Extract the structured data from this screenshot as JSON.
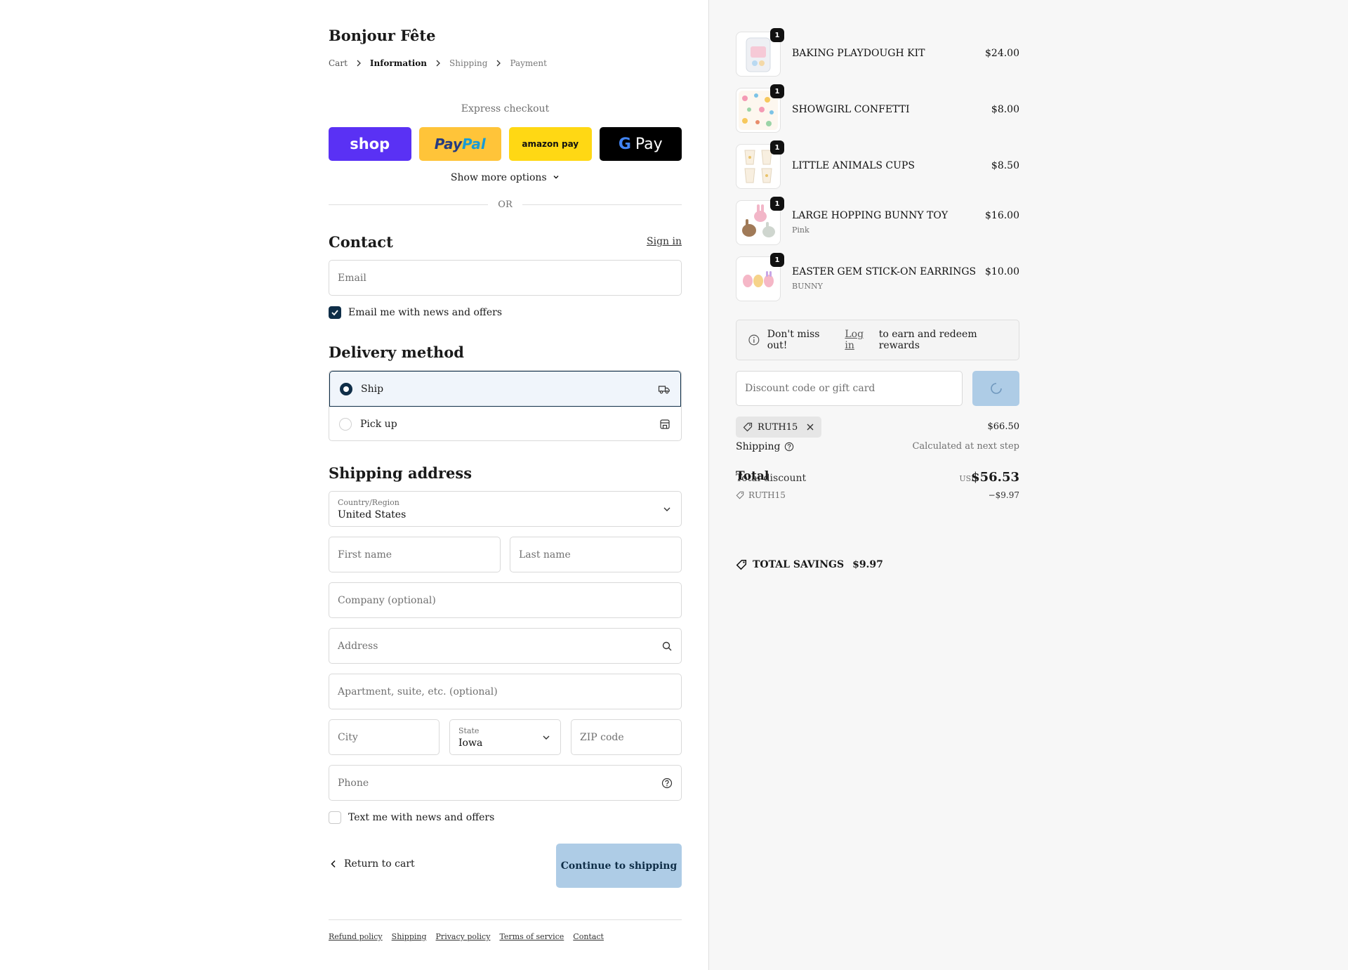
{
  "shop": {
    "name": "Bonjour Fête"
  },
  "breadcrumb": [
    "Cart",
    "Information",
    "Shipping",
    "Payment"
  ],
  "express": {
    "label": "Express checkout",
    "shop": "shop",
    "paypal_a": "Pay",
    "paypal_b": "Pal",
    "amazon": "amazon pay",
    "google_g": "G",
    "google_pay": "Pay",
    "more_options": "Show more options"
  },
  "or_label": "OR",
  "contact": {
    "heading": "Contact",
    "sign_in": "Sign in",
    "email_placeholder": "Email",
    "newsletter_label": "Email me with news and offers",
    "newsletter_checked": true
  },
  "delivery": {
    "heading": "Delivery method",
    "options": [
      {
        "label": "Ship",
        "selected": true,
        "icon": "truck-icon"
      },
      {
        "label": "Pick up",
        "selected": false,
        "icon": "store-icon"
      }
    ]
  },
  "shipping": {
    "heading": "Shipping address",
    "country_label": "Country/Region",
    "country_value": "United States",
    "first_name": "First name",
    "last_name": "Last name",
    "company": "Company (optional)",
    "address": "Address",
    "apartment": "Apartment, suite, etc. (optional)",
    "city": "City",
    "state_label": "State",
    "state_value": "Iowa",
    "zip": "ZIP code",
    "phone": "Phone",
    "sms_label": "Text me with news and offers"
  },
  "actions": {
    "return": "Return to cart",
    "continue": "Continue to shipping"
  },
  "footer": [
    "Refund policy",
    "Shipping",
    "Privacy policy",
    "Terms of service",
    "Contact"
  ],
  "cart": {
    "items": [
      {
        "name": "BAKING PLAYDOUGH KIT",
        "variant": "",
        "qty": "1",
        "price": "$24.00"
      },
      {
        "name": "SHOWGIRL CONFETTI",
        "variant": "",
        "qty": "1",
        "price": "$8.00"
      },
      {
        "name": "LITTLE ANIMALS CUPS",
        "variant": "",
        "qty": "1",
        "price": "$8.50"
      },
      {
        "name": "LARGE HOPPING BUNNY TOY",
        "variant": "Pink",
        "qty": "1",
        "price": "$16.00"
      },
      {
        "name": "EASTER GEM STICK-ON EARRINGS",
        "variant": "BUNNY",
        "qty": "1",
        "price": "$10.00"
      }
    ],
    "rewards_a": "Don't miss out!",
    "rewards_link": "Log in",
    "rewards_b": "to earn and redeem rewards",
    "discount_placeholder": "Discount code or gift card",
    "applied_code": "RUTH15",
    "subtotal": "$66.50",
    "shipping_label": "Shipping",
    "shipping_value": "Calculated at next step",
    "total_label": "Total",
    "total_discount_label": "Total discount",
    "currency": "USD",
    "total": "$56.53",
    "discount_code": "RUTH15",
    "discount_amount": "−$9.97",
    "savings_label": "TOTAL SAVINGS",
    "savings_value": "$9.97"
  }
}
